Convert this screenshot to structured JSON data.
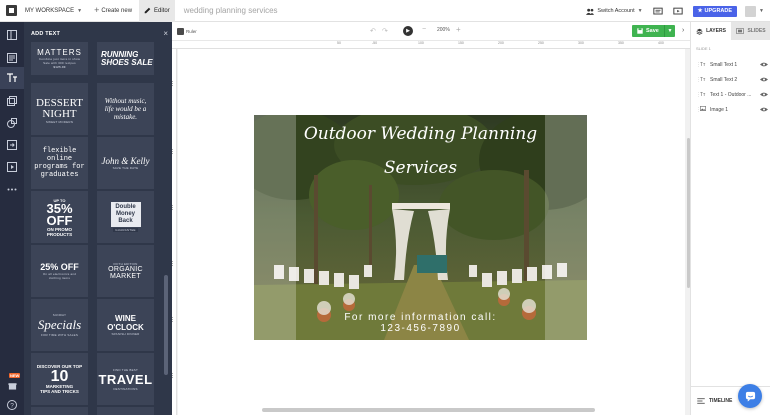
{
  "topbar": {
    "workspace_label": "MY WORKSPACE",
    "create_label": "Create new",
    "editor_label": "Editor",
    "doc_title": "wedding planning services",
    "switch_account_label": "Switch Account",
    "upgrade_label": "UPGRADE"
  },
  "panel": {
    "title": "ADD TEXT",
    "templates": [
      {
        "line1": "MATTERS",
        "line2": "Combine just more in show",
        "line3": "Sale with 300 recipes",
        "line4": "$125.00"
      },
      {
        "line1": "RUNNING",
        "line2": "SHOES SALE"
      },
      {
        "line1": "DESSERT",
        "line2": "NIGHT",
        "line3": "SWEET MODERN"
      },
      {
        "line1": "Without music,",
        "line2": "life would be a",
        "line3": "mistake."
      },
      {
        "line1": "flexible",
        "line2": "online",
        "line3": "programs for",
        "line4": "graduates"
      },
      {
        "line1": "John & Kelly",
        "line2": "SAVE THE DATE"
      },
      {
        "line1": "UP TO",
        "line2": "35%",
        "line3": "OFF",
        "line4": "ON PROMO",
        "line5": "PRODUCTS"
      },
      {
        "line1": "Double",
        "line2": "Money",
        "line3": "Back",
        "line4": "GUARANTEE"
      },
      {
        "line1": "25% OFF",
        "line2": "On all electronics and",
        "line3": "clothing items"
      },
      {
        "line1": "FIFTH EDITION",
        "line2": "ORGANIC MARKET"
      },
      {
        "line1": "Specials",
        "line2": "SUNDAY",
        "line3": "FOR TIME WITH SALES"
      },
      {
        "line1": "WINE O'CLOCK",
        "line2": "SPANISH DINNER"
      },
      {
        "line1": "DISCOVER OUR TOP",
        "line2": "10",
        "line3": "MARKETING",
        "line4": "TIPS AND TRICKS"
      },
      {
        "line1": "FIND THE BEST",
        "line2": "TRAVEL",
        "line3": "DESTINATIONS"
      }
    ]
  },
  "toolbar": {
    "ruler_label": "Ruler",
    "zoom_label": "200%",
    "save_label": "Save"
  },
  "ruler": {
    "ticks": [
      "50",
      "-50",
      "100",
      "150",
      "200",
      "250",
      "300",
      "350",
      "400"
    ]
  },
  "artboard": {
    "title_line1": "Outdoor Wedding Planning",
    "title_line2": "Services",
    "info_line1": "For more information call:",
    "info_line2": "123-456-7890"
  },
  "layers_panel": {
    "tab_layers": "LAYERS",
    "tab_slides": "SLIDES",
    "slide_label": "SLIDE 1",
    "layers": [
      {
        "type": "Tт",
        "name": "Small Text 1"
      },
      {
        "type": "Tт",
        "name": "Small Text 2"
      },
      {
        "type": "Tт",
        "name": "Text 1 - Outdoor ..."
      },
      {
        "type": "img",
        "name": "Image 1"
      }
    ],
    "timeline_label": "TIMELINE"
  },
  "new_badge": "NEW",
  "colors": {
    "rail": "#262c3f",
    "panel": "#2f3749",
    "card": "#3c4457",
    "upgrade": "#4a63e8",
    "save": "#3fb350",
    "chat": "#3d7fe6"
  }
}
